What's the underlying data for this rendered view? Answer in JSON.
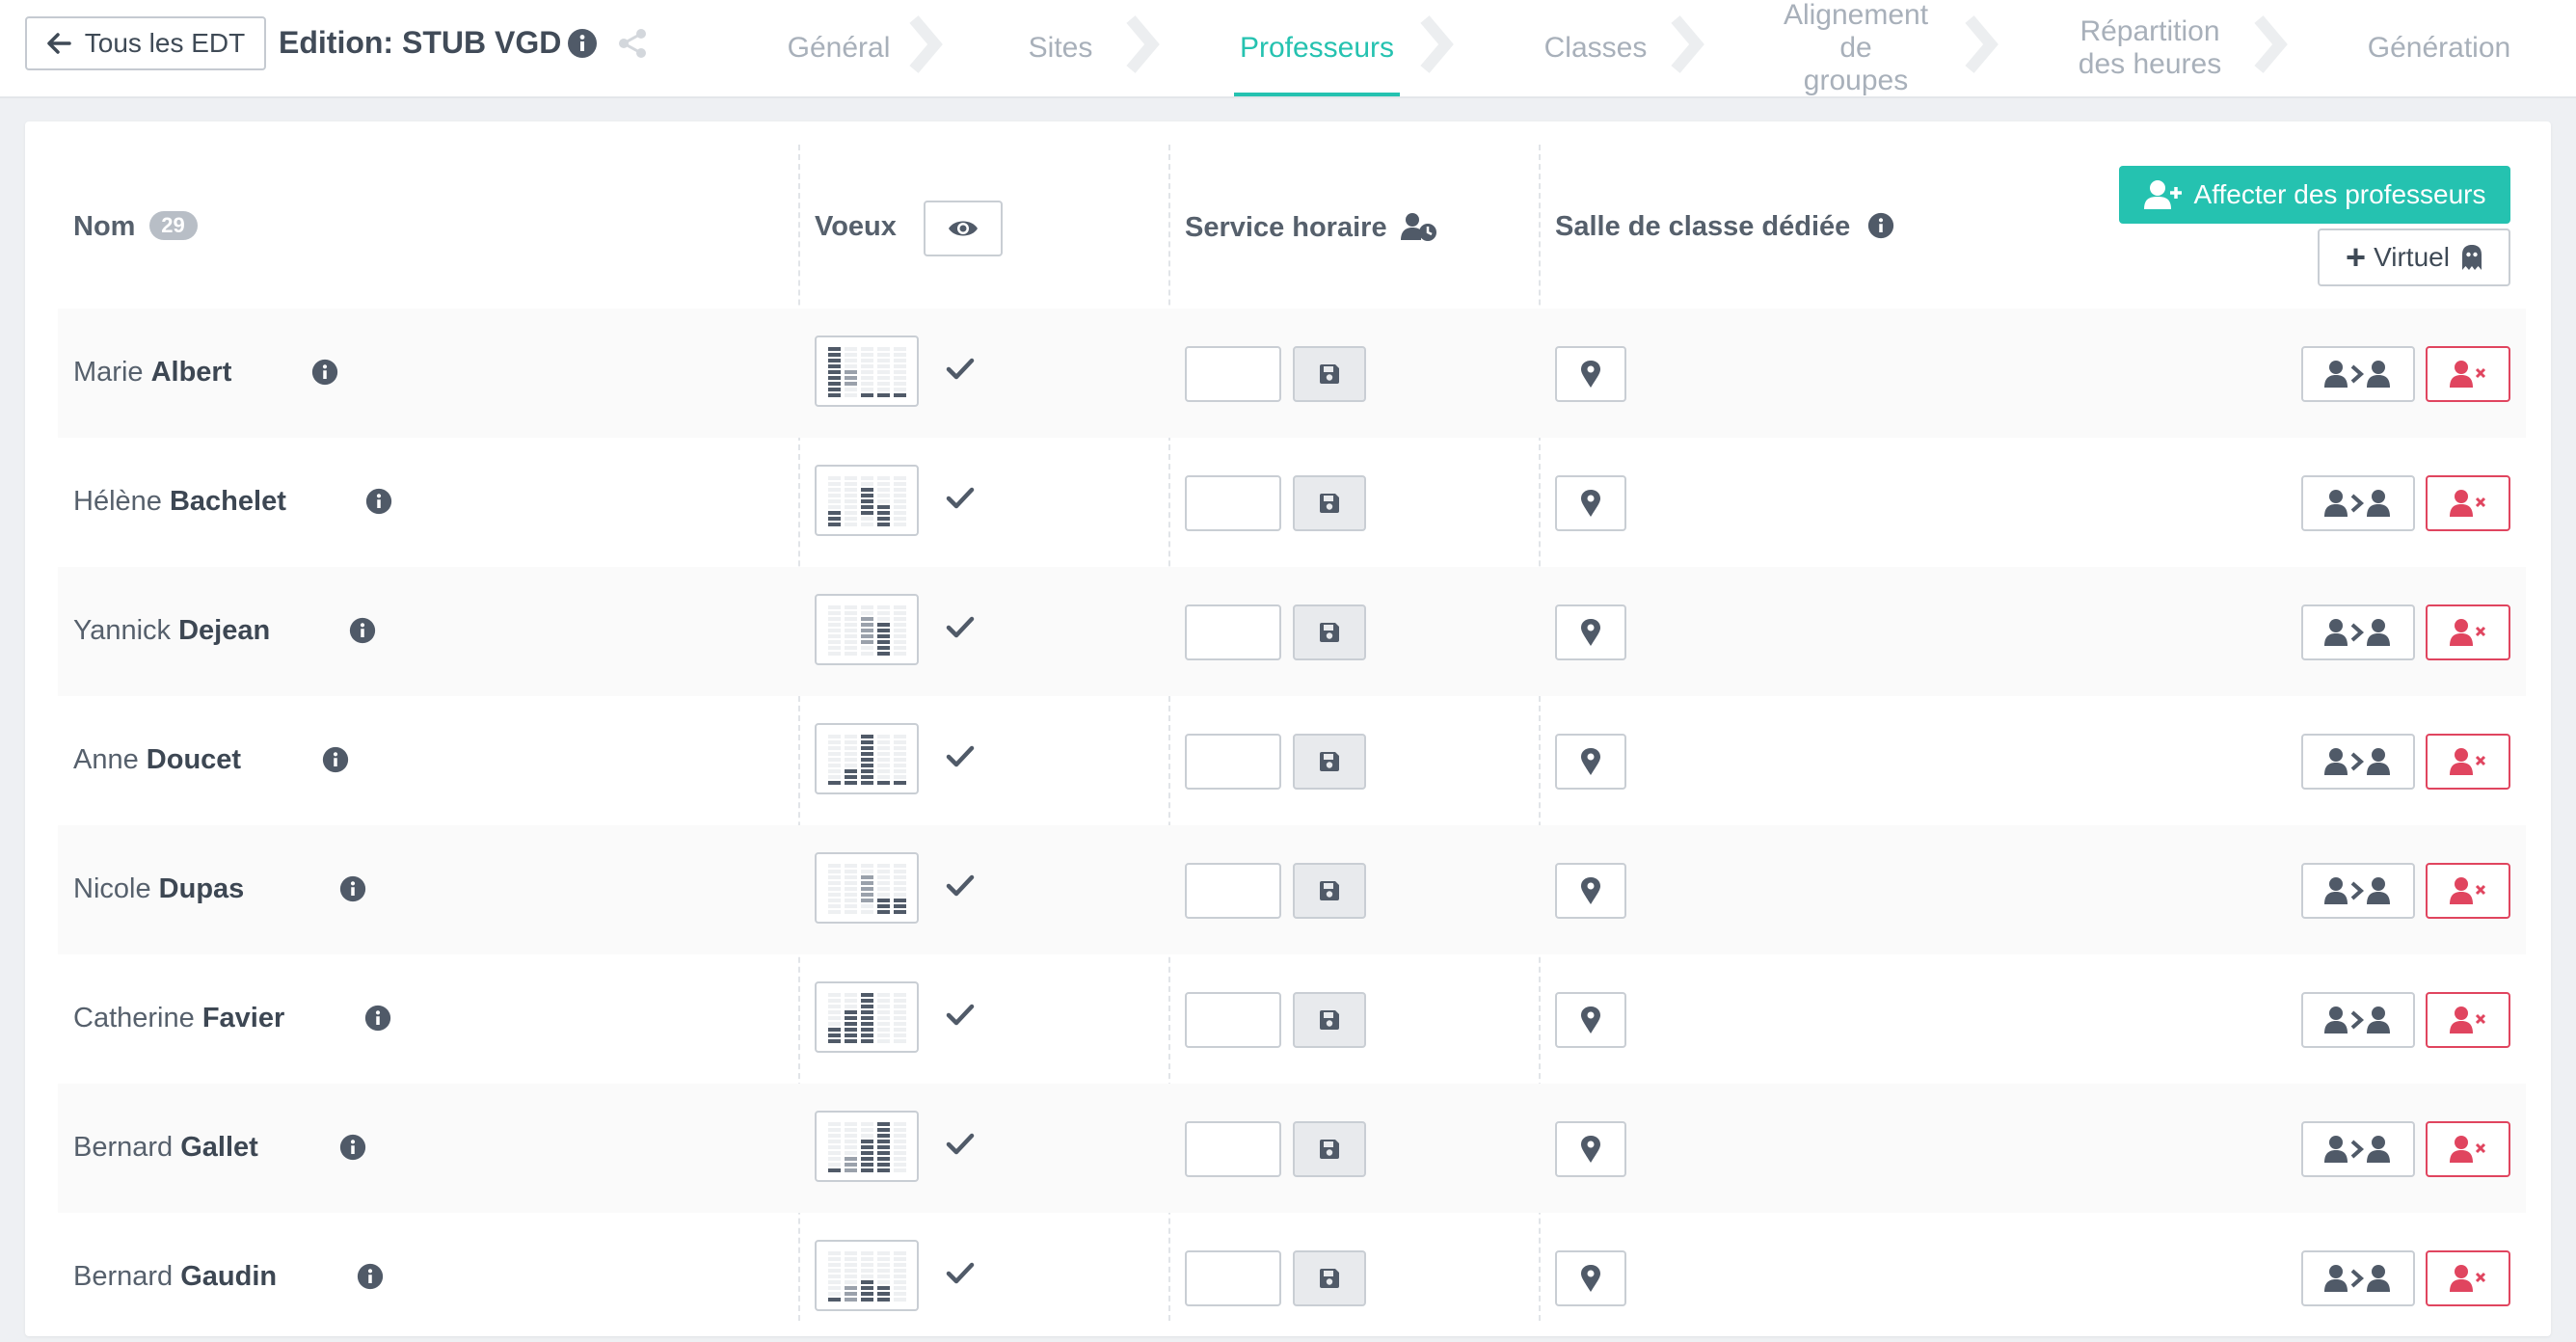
{
  "header": {
    "back_label": "Tous les EDT",
    "title": "Edition: STUB VGD"
  },
  "steps": [
    {
      "label": "Général"
    },
    {
      "label": "Sites"
    },
    {
      "label": "Professeurs",
      "active": true
    },
    {
      "label": "Classes"
    },
    {
      "label": "Alignement de groupes",
      "line1": "Alignement",
      "line2": "de groupes"
    },
    {
      "label": "Répartition des heures",
      "line1": "Répartition",
      "line2": "des heures"
    },
    {
      "label": "Génération"
    }
  ],
  "table": {
    "col_name": "Nom",
    "count": "29",
    "col_voeux": "Voeux",
    "col_service": "Service horaire",
    "col_salle": "Salle de classe dédiée",
    "assign_label": "Affecter des professeurs",
    "virtual_label": "Virtuel"
  },
  "teachers": [
    {
      "first": "Marie",
      "last": "Albert",
      "hours": ""
    },
    {
      "first": "Hélène",
      "last": "Bachelet",
      "hours": ""
    },
    {
      "first": "Yannick",
      "last": "Dejean",
      "hours": ""
    },
    {
      "first": "Anne",
      "last": "Doucet",
      "hours": ""
    },
    {
      "first": "Nicole",
      "last": "Dupas",
      "hours": ""
    },
    {
      "first": "Catherine",
      "last": "Favier",
      "hours": ""
    },
    {
      "first": "Bernard",
      "last": "Gallet",
      "hours": ""
    },
    {
      "first": "Bernard",
      "last": "Gaudin",
      "hours": ""
    }
  ],
  "colors": {
    "accent": "#25c2b0",
    "danger": "#e0455f",
    "text": "#505a68"
  }
}
